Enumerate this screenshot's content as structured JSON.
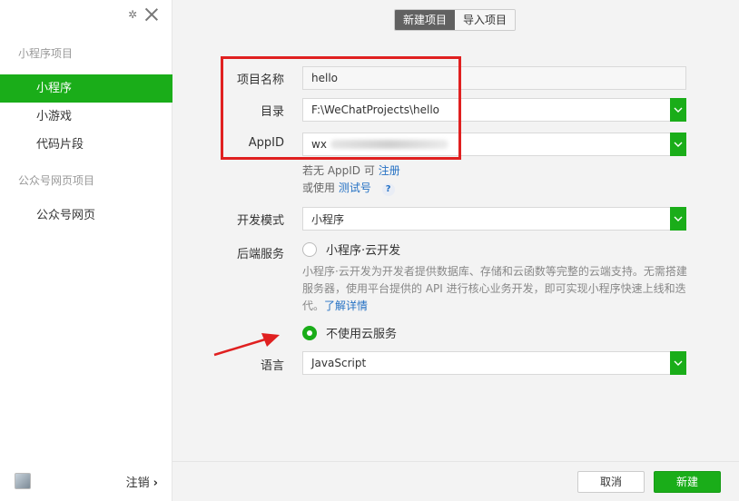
{
  "sidebar": {
    "section_miniprogram": "小程序项目",
    "items": [
      {
        "label": "小程序"
      },
      {
        "label": "小游戏"
      },
      {
        "label": "代码片段"
      }
    ],
    "section_official": "公众号网页项目",
    "official_item": "公众号网页",
    "logout": "注销",
    "logout_chevron": "›"
  },
  "tabs": {
    "new_project": "新建项目",
    "import_project": "导入项目"
  },
  "form": {
    "project_name_label": "项目名称",
    "project_name_value": "hello",
    "directory_label": "目录",
    "directory_value": "F:\\WeChatProjects\\hello",
    "appid_label": "AppID",
    "appid_value": "wx",
    "no_appid_text": "若无 AppID 可",
    "register_link": "注册",
    "or_use_text": "或使用",
    "test_id_link": "测试号",
    "help_mark": "?",
    "dev_mode_label": "开发模式",
    "dev_mode_value": "小程序",
    "backend_label": "后端服务",
    "cloud_option": "小程序·云开发",
    "cloud_desc": "小程序·云开发为开发者提供数据库、存储和云函数等完整的云端支持。无需搭建服务器，使用平台提供的 API 进行核心业务开发，即可实现小程序快速上线和迭代。",
    "learn_more_link": "了解详情",
    "no_cloud_option": "不使用云服务",
    "language_label": "语言",
    "language_value": "JavaScript"
  },
  "footer": {
    "cancel": "取消",
    "create": "新建"
  },
  "colors": {
    "accent": "#1aad19",
    "link": "#2672c4",
    "annotation": "#e02020"
  }
}
